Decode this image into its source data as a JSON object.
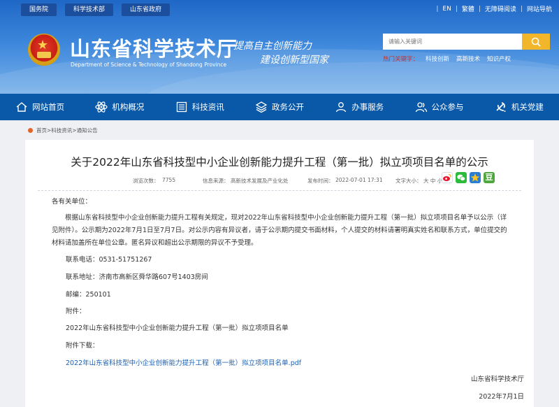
{
  "top_links": [
    "国务院",
    "科学技术部",
    "山东省政府"
  ],
  "right_links": [
    "EN",
    "繁體",
    "无障碍阅读",
    "网站导航"
  ],
  "header": {
    "site_title": "山东省科学技术厅",
    "site_subtitle": "Department of Science & Technology of Shandong Province",
    "slogan_line1": "提高自主创新能力",
    "slogan_line2": "建设创新型国家"
  },
  "search": {
    "placeholder": "请输入关键词",
    "hot_label": "热门关键字：",
    "hot_words": [
      "科技创新",
      "高新技术",
      "知识产权"
    ]
  },
  "nav": {
    "items": [
      "网站首页",
      "机构概况",
      "科技资讯",
      "政务公开",
      "办事服务",
      "公众参与",
      "机关党建"
    ]
  },
  "breadcrumb": "首页>科技资讯>通知公告",
  "article": {
    "title": "关于2022年山东省科技型中小企业创新能力提升工程（第一批）拟立项项目名单的公示",
    "views_label": "浏览次数：",
    "views": "7755",
    "source_label": "信息来源：",
    "source": "高新技术发展及产业化处",
    "date_label": "发布时间：",
    "date": "2022-07-01 17:31",
    "font_label": "文字大小：",
    "font_options": "大 中 小",
    "salutation": "各有关单位：",
    "body": "根据山东省科技型中小企业创新能力提升工程有关规定，现对2022年山东省科技型中小企业创新能力提升工程（第一批）拟立项项目名单予以公示（详见附件）。公示期为2022年7月1日至7月7日。对公示内容有异议者，请于公示期内提交书面材料，个人提交的材料请署明真实姓名和联系方式，单位提交的材料请加盖所在单位公章。匿名异议和超出公示期限的异议不予受理。",
    "phone": "联系电话：0531-51751267",
    "address": "联系地址：济南市高新区舜华路607号1403房间",
    "postcode": "邮编：250101",
    "attachment_label": "附件：",
    "attachment_name": "2022年山东省科技型中小企业创新能力提升工程（第一批）拟立项项目名单",
    "download_label": "附件下载：",
    "download_link": "2022年山东省科技型中小企业创新能力提升工程（第一批）拟立项项目名单.pdf",
    "signature": "山东省科学技术厅",
    "sign_date": "2022年7月1日"
  }
}
